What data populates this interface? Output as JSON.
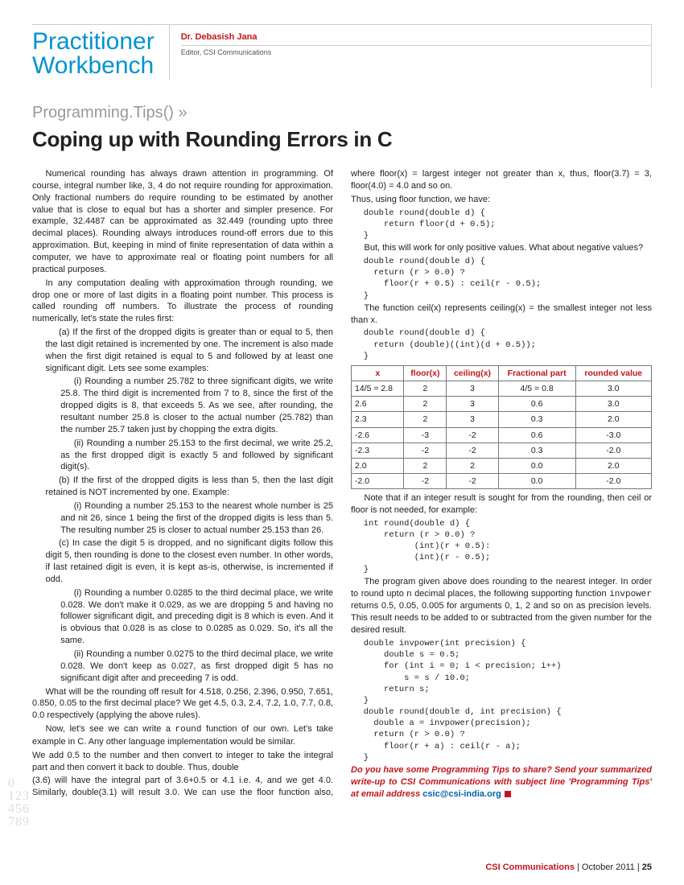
{
  "header": {
    "workbench_l1": "Practitioner",
    "workbench_l2": "Workbench",
    "author": "Dr. Debasish Jana",
    "role": "Editor, CSI Communications"
  },
  "section": "Programming.Tips() »",
  "title": "Coping up with Rounding Errors in C",
  "body": {
    "p1": "Numerical rounding has always drawn attention in programming. Of course, integral number like, 3, 4 do not require rounding for approximation. Only fractional numbers do require rounding to be estimated by another value that is close to equal but has a shorter and simpler presence. For example, 32.4487 can be approximated as 32.449 (rounding upto three decimal places). Rounding always introduces round-off errors due to this approximation. But, keeping in mind of finite representation of data within a computer, we have to approximate real or floating point numbers for all practical purposes.",
    "p2": "In any computation dealing with approximation through rounding, we drop one or more of last digits in a floating point number. This process is called rounding off numbers. To illustrate the process of rounding numerically, let's state the rules first:",
    "a1": "(a)  If the first of the dropped digits is greater than or equal to 5, then the last digit retained is incremented by one. The increment is also made when the first digit retained is equal to 5 and followed by at least one significant digit. Lets see some examples:",
    "a1i": "(i)   Rounding a number 25.782 to three significant digits, we write 25.8. The third digit is incremented from 7 to 8, since the first of the dropped digits is 8, that exceeds 5. As we see, after rounding, the resultant number 25.8 is closer to the actual number (25.782) than the number 25.7 taken just by chopping the extra digits.",
    "a1ii": "(ii)  Rounding a number 25.153 to the first decimal, we write 25.2, as the first dropped digit is exactly 5 and followed by significant digit(s).",
    "b1": "(b)  If the first of the dropped digits is less than 5, then the last digit retained is NOT incremented by one. Example:",
    "b1i": "(i)   Rounding a number 25.153 to the nearest whole number is 25 and nit 26, since 1 being the first of the dropped digits is less than 5. The resulting number 25 is closer to actual number 25.153 than 26.",
    "c1": "(c)  In case the digit 5 is dropped, and no significant digits follow this digit 5, then rounding is done to the closest even number. In other words, if last retained digit is even, it is kept as-is, otherwise, is incremented if odd.",
    "c1i": "(i)   Rounding a number 0.0285 to the third decimal place, we write 0.028. We don't make it 0.029, as we are dropping 5 and having no follower significant digit, and preceding digit is 8 which is even. And it is obvious that 0.028 is as close to 0.0285 as 0.029. So, it's all the same.",
    "c1ii": "(ii)   Rounding a number 0.0275 to the third decimal place, we write 0.028. We don't keep as 0.027, as first dropped digit 5 has no significant digit after and preceeding 7 is odd.",
    "p3": "What will be the rounding off result for 4.518, 0.256, 2.396, 0.950, 7.651, 0.850, 0.05 to the first decimal place? We get 4.5, 0.3, 2.4, 7.2, 1.0, 7.7, 0.8, 0.0 respectively (applying the above rules).",
    "p4a": "Now, let's see we can write a ",
    "p4b": " function of our own. Let's take example in C. Any other language implementation would be similar.",
    "p4code": "round",
    "p5": "We add 0.5 to the number and then convert to integer to take the integral part and then convert it back to double. Thus, double",
    "r1": "(3.6) will have the integral part of 3.6+0.5 or 4.1 i.e. 4, and we get 4.0. Similarly, double(3.1) will result 3.0. We can use the floor function also, where floor(x) = largest integer not greater than x, thus, floor(3.7) = 3, floor(4.0) = 4.0 and so on.",
    "r2": "Thus, using floor function, we have:",
    "code1": "double round(double d) {\n    return floor(d + 0.5);\n}",
    "r3": "But, this will work for only positive values. What about negative values?",
    "code2": "double round(double d) {\n  return (r > 0.0) ?\n    floor(r + 0.5) : ceil(r - 0.5);\n}",
    "r4": "The function ceil(x) represents ceiling(x) = the smallest integer not less than x.",
    "code3": "double round(double d) {\n  return (double)((int)(d + 0.5));\n}",
    "r5": "Note that if an integer result is sought for from the rounding, then ceil or floor is not needed, for example:",
    "code4": "int round(double d) {\n    return (r > 0.0) ?\n          (int)(r + 0.5):\n          (int)(r - 0.5);\n}",
    "r6a": "The program given above does rounding to the nearest integer.  In order to round upto n decimal places, the following supporting function ",
    "r6b": " returns 0.5, 0.05, 0.005 for arguments 0, 1, 2 and so on as precision levels. This result needs to be added to or subtracted from the given number for the desired result.",
    "r6code": "invpower",
    "code5": "double invpower(int precision) {\n    double s = 0.5;\n    for (int i = 0; i < precision; i++)\n        s = s / 10.0;\n    return s;\n}\ndouble round(double d, int precision) {\n  double a = invpower(precision);\n  return (r > 0.0) ?\n    floor(r + a) : ceil(r - a);\n}",
    "cta": "Do you have some Programming Tips to share? Send your summarized write-up to CSI Communications with subject line 'Programming Tips' at email address ",
    "email": "csic@csi-india.org"
  },
  "table": {
    "headers": [
      "x",
      "floor(x)",
      "ceiling(x)",
      "Fractional part",
      "rounded value"
    ],
    "rows": [
      [
        "14/5 = 2.8",
        "2",
        "3",
        "4/5 = 0.8",
        "3.0"
      ],
      [
        "2.6",
        "2",
        "3",
        "0.6",
        "3.0"
      ],
      [
        "2.3",
        "2",
        "3",
        "0.3",
        "2.0"
      ],
      [
        "-2.6",
        "-3",
        "-2",
        "0.6",
        "-3.0"
      ],
      [
        "-2.3",
        "-2",
        "-2",
        "0.3",
        "-2.0"
      ],
      [
        "2.0",
        "2",
        "2",
        "0.0",
        "2.0"
      ],
      [
        "-2.0",
        "-2",
        "-2",
        "0.0",
        "-2.0"
      ]
    ]
  },
  "footer": {
    "pub": "CSI Communications",
    "date": "October 2011",
    "page": "25"
  },
  "watermark": "0\n123\n456\n789"
}
